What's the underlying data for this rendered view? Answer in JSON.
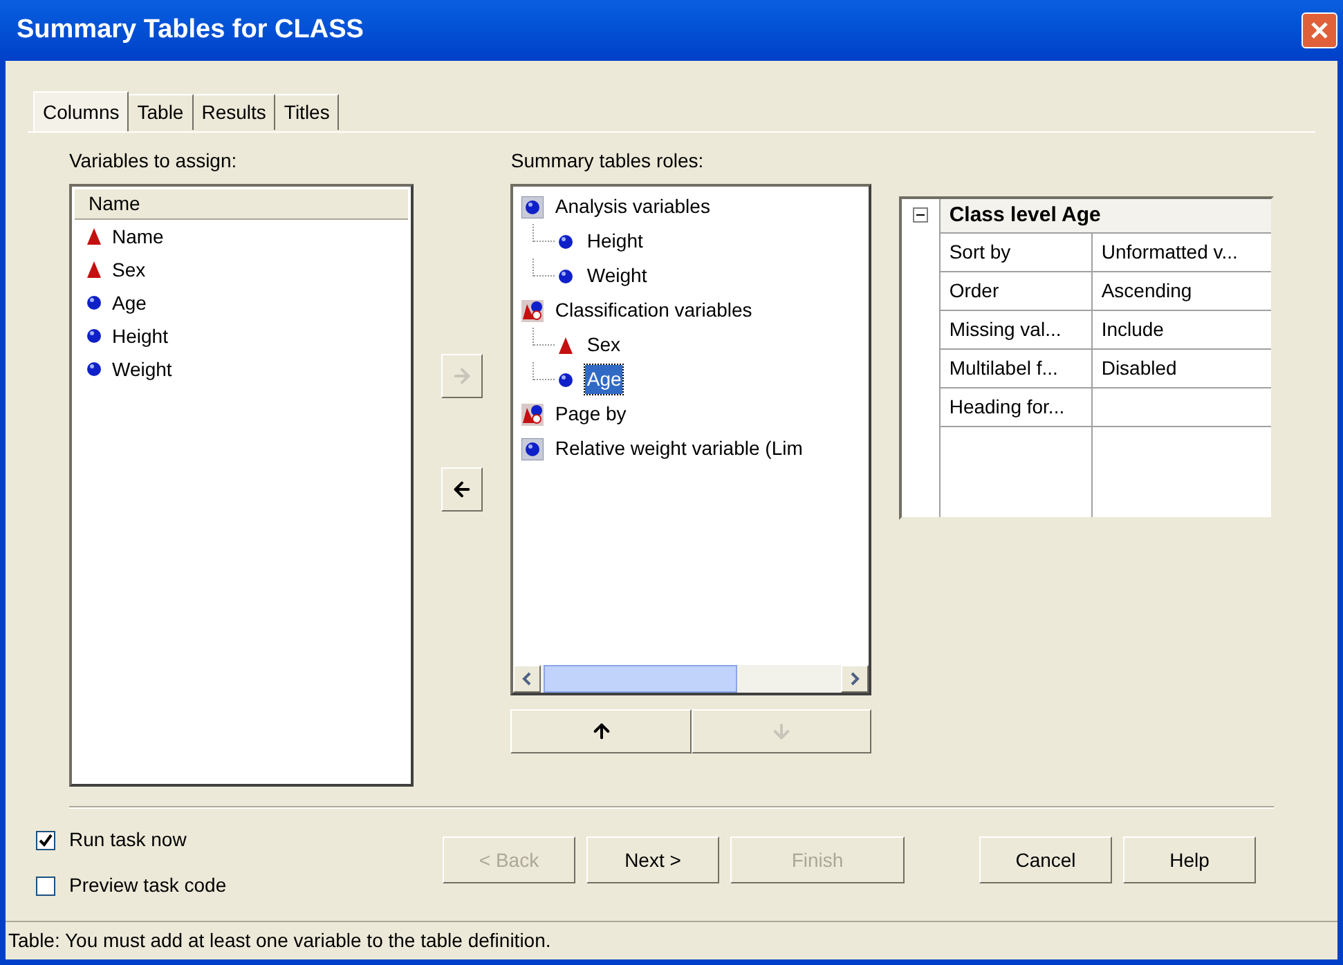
{
  "window": {
    "title": "Summary Tables for CLASS"
  },
  "tabs": [
    {
      "label": "Columns",
      "selected": true
    },
    {
      "label": "Table",
      "selected": false
    },
    {
      "label": "Results",
      "selected": false
    },
    {
      "label": "Titles",
      "selected": false
    }
  ],
  "variables": {
    "label": "Variables to assign:",
    "column": "Name",
    "items": [
      {
        "name": "Name",
        "kind": "character"
      },
      {
        "name": "Sex",
        "kind": "character"
      },
      {
        "name": "Age",
        "kind": "numeric"
      },
      {
        "name": "Height",
        "kind": "numeric"
      },
      {
        "name": "Weight",
        "kind": "numeric"
      }
    ]
  },
  "move_buttons": [
    {
      "kind": "right",
      "disabled": true
    },
    {
      "kind": "left",
      "disabled": false
    }
  ],
  "roles": {
    "label": "Summary tables roles:",
    "items": [
      {
        "name": "Analysis variables",
        "kind": "numeric",
        "children": [
          {
            "name": "Height",
            "kind": "numeric",
            "selected": false
          },
          {
            "name": "Weight",
            "kind": "numeric",
            "selected": false
          }
        ]
      },
      {
        "name": "Classification variables",
        "kind": "class",
        "children": [
          {
            "name": "Sex",
            "kind": "character",
            "selected": false
          },
          {
            "name": "Age",
            "kind": "numeric",
            "selected": true
          }
        ]
      },
      {
        "name": "Page by",
        "kind": "class"
      },
      {
        "name": "Relative weight variable  (Lim",
        "kind": "numeric"
      }
    ]
  },
  "order_buttons": [
    {
      "kind": "up",
      "disabled": false
    },
    {
      "kind": "down",
      "disabled": true
    }
  ],
  "properties": {
    "title": "Class level Age",
    "expanded": true,
    "rows": [
      {
        "name": "Sort by",
        "value": "Unformatted v..."
      },
      {
        "name": "Order",
        "value": "Ascending"
      },
      {
        "name": "Missing val...",
        "value": "Include"
      },
      {
        "name": "Multilabel f...",
        "value": "Disabled"
      },
      {
        "name": "Heading for..."
      }
    ]
  },
  "options": [
    {
      "label": "Run task now",
      "checked": true
    },
    {
      "label": "Preview task code",
      "checked": false
    }
  ],
  "buttons": [
    {
      "label": "< Back",
      "disabled": true
    },
    {
      "label": "Next >",
      "disabled": false
    },
    {
      "label": "Finish",
      "disabled": true
    },
    {
      "label": "Cancel",
      "disabled": false
    },
    {
      "label": "Help",
      "disabled": false
    }
  ],
  "status_bar": "Table: You must add at least one variable to the table definition."
}
